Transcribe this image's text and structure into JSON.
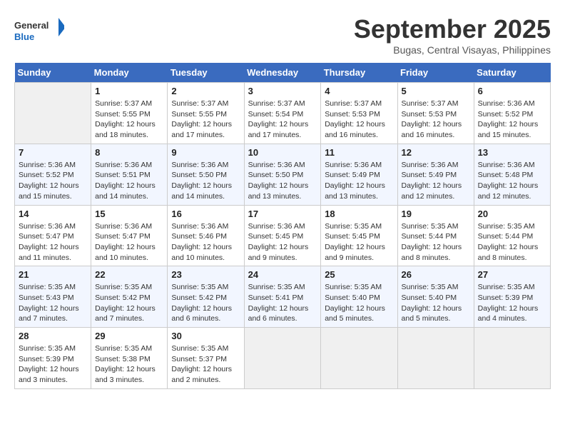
{
  "header": {
    "logo_general": "General",
    "logo_blue": "Blue",
    "month_year": "September 2025",
    "location": "Bugas, Central Visayas, Philippines"
  },
  "days_of_week": [
    "Sunday",
    "Monday",
    "Tuesday",
    "Wednesday",
    "Thursday",
    "Friday",
    "Saturday"
  ],
  "weeks": [
    [
      {
        "day": "",
        "empty": true
      },
      {
        "day": "1",
        "sunrise": "5:37 AM",
        "sunset": "5:55 PM",
        "daylight": "12 hours and 18 minutes."
      },
      {
        "day": "2",
        "sunrise": "5:37 AM",
        "sunset": "5:55 PM",
        "daylight": "12 hours and 17 minutes."
      },
      {
        "day": "3",
        "sunrise": "5:37 AM",
        "sunset": "5:54 PM",
        "daylight": "12 hours and 17 minutes."
      },
      {
        "day": "4",
        "sunrise": "5:37 AM",
        "sunset": "5:53 PM",
        "daylight": "12 hours and 16 minutes."
      },
      {
        "day": "5",
        "sunrise": "5:37 AM",
        "sunset": "5:53 PM",
        "daylight": "12 hours and 16 minutes."
      },
      {
        "day": "6",
        "sunrise": "5:36 AM",
        "sunset": "5:52 PM",
        "daylight": "12 hours and 15 minutes."
      }
    ],
    [
      {
        "day": "7",
        "sunrise": "5:36 AM",
        "sunset": "5:52 PM",
        "daylight": "12 hours and 15 minutes."
      },
      {
        "day": "8",
        "sunrise": "5:36 AM",
        "sunset": "5:51 PM",
        "daylight": "12 hours and 14 minutes."
      },
      {
        "day": "9",
        "sunrise": "5:36 AM",
        "sunset": "5:50 PM",
        "daylight": "12 hours and 14 minutes."
      },
      {
        "day": "10",
        "sunrise": "5:36 AM",
        "sunset": "5:50 PM",
        "daylight": "12 hours and 13 minutes."
      },
      {
        "day": "11",
        "sunrise": "5:36 AM",
        "sunset": "5:49 PM",
        "daylight": "12 hours and 13 minutes."
      },
      {
        "day": "12",
        "sunrise": "5:36 AM",
        "sunset": "5:49 PM",
        "daylight": "12 hours and 12 minutes."
      },
      {
        "day": "13",
        "sunrise": "5:36 AM",
        "sunset": "5:48 PM",
        "daylight": "12 hours and 12 minutes."
      }
    ],
    [
      {
        "day": "14",
        "sunrise": "5:36 AM",
        "sunset": "5:47 PM",
        "daylight": "12 hours and 11 minutes."
      },
      {
        "day": "15",
        "sunrise": "5:36 AM",
        "sunset": "5:47 PM",
        "daylight": "12 hours and 10 minutes."
      },
      {
        "day": "16",
        "sunrise": "5:36 AM",
        "sunset": "5:46 PM",
        "daylight": "12 hours and 10 minutes."
      },
      {
        "day": "17",
        "sunrise": "5:36 AM",
        "sunset": "5:45 PM",
        "daylight": "12 hours and 9 minutes."
      },
      {
        "day": "18",
        "sunrise": "5:35 AM",
        "sunset": "5:45 PM",
        "daylight": "12 hours and 9 minutes."
      },
      {
        "day": "19",
        "sunrise": "5:35 AM",
        "sunset": "5:44 PM",
        "daylight": "12 hours and 8 minutes."
      },
      {
        "day": "20",
        "sunrise": "5:35 AM",
        "sunset": "5:44 PM",
        "daylight": "12 hours and 8 minutes."
      }
    ],
    [
      {
        "day": "21",
        "sunrise": "5:35 AM",
        "sunset": "5:43 PM",
        "daylight": "12 hours and 7 minutes."
      },
      {
        "day": "22",
        "sunrise": "5:35 AM",
        "sunset": "5:42 PM",
        "daylight": "12 hours and 7 minutes."
      },
      {
        "day": "23",
        "sunrise": "5:35 AM",
        "sunset": "5:42 PM",
        "daylight": "12 hours and 6 minutes."
      },
      {
        "day": "24",
        "sunrise": "5:35 AM",
        "sunset": "5:41 PM",
        "daylight": "12 hours and 6 minutes."
      },
      {
        "day": "25",
        "sunrise": "5:35 AM",
        "sunset": "5:40 PM",
        "daylight": "12 hours and 5 minutes."
      },
      {
        "day": "26",
        "sunrise": "5:35 AM",
        "sunset": "5:40 PM",
        "daylight": "12 hours and 5 minutes."
      },
      {
        "day": "27",
        "sunrise": "5:35 AM",
        "sunset": "5:39 PM",
        "daylight": "12 hours and 4 minutes."
      }
    ],
    [
      {
        "day": "28",
        "sunrise": "5:35 AM",
        "sunset": "5:39 PM",
        "daylight": "12 hours and 3 minutes."
      },
      {
        "day": "29",
        "sunrise": "5:35 AM",
        "sunset": "5:38 PM",
        "daylight": "12 hours and 3 minutes."
      },
      {
        "day": "30",
        "sunrise": "5:35 AM",
        "sunset": "5:37 PM",
        "daylight": "12 hours and 2 minutes."
      },
      {
        "day": "",
        "empty": true
      },
      {
        "day": "",
        "empty": true
      },
      {
        "day": "",
        "empty": true
      },
      {
        "day": "",
        "empty": true
      }
    ]
  ],
  "labels": {
    "sunrise_prefix": "Sunrise: ",
    "sunset_prefix": "Sunset: ",
    "daylight_prefix": "Daylight: "
  }
}
